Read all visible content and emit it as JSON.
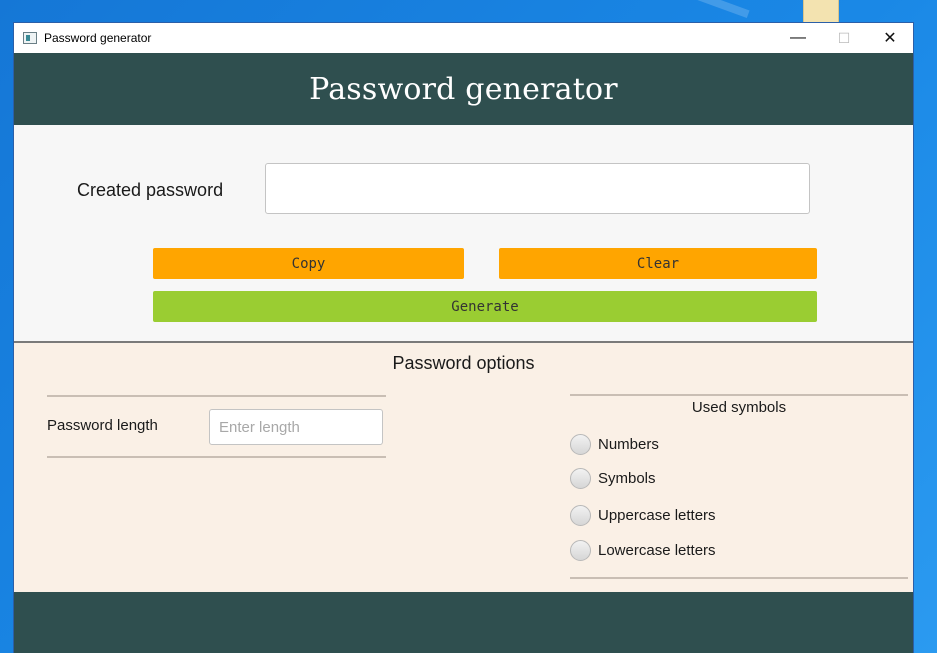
{
  "window": {
    "title": "Password generator",
    "controls": {
      "minimize": "—",
      "maximize": "☐",
      "close": "✕"
    }
  },
  "header": {
    "title": "Password generator"
  },
  "password_section": {
    "label": "Created password",
    "value": "",
    "buttons": {
      "copy": "Copy",
      "clear": "Clear",
      "generate": "Generate"
    }
  },
  "options": {
    "title": "Password options",
    "length": {
      "label": "Password length",
      "placeholder": "Enter length"
    },
    "symbols": {
      "title": "Used symbols",
      "items": [
        {
          "label": "Numbers"
        },
        {
          "label": "Symbols"
        },
        {
          "label": "Uppercase letters"
        },
        {
          "label": "Lowercase letters"
        }
      ]
    }
  },
  "colors": {
    "header_bg": "#2f4f4f",
    "copy_clear_bg": "#ffa500",
    "generate_bg": "#9acd32",
    "options_bg": "#faf0e6"
  }
}
